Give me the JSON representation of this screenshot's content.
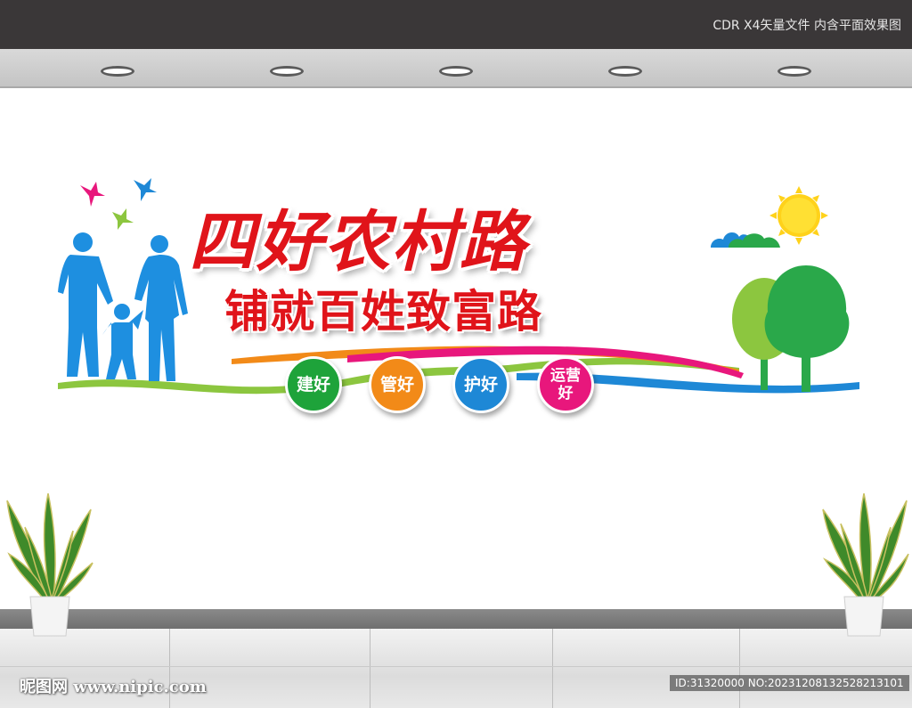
{
  "header": {
    "caption": "CDR X4矢量文件  内含平面效果图"
  },
  "signboard": {
    "title": "四好农村路",
    "subtitle": "铺就百姓致富路",
    "badges": [
      {
        "label": "建好",
        "color": "#1ea33a"
      },
      {
        "label": "管好",
        "color": "#f28a18"
      },
      {
        "label": "护好",
        "color": "#1e88d6"
      },
      {
        "label": "运营好",
        "color": "#e8177c"
      }
    ]
  },
  "watermark": {
    "site": "昵图网 www.nipic.com",
    "id_text": "ID:31320000 NO:20231208132528213101"
  },
  "colors": {
    "title_red": "#e0141a",
    "family_blue": "#1e8fe0",
    "tree_green": "#2aa84a",
    "sun_yellow": "#ffd21a"
  }
}
